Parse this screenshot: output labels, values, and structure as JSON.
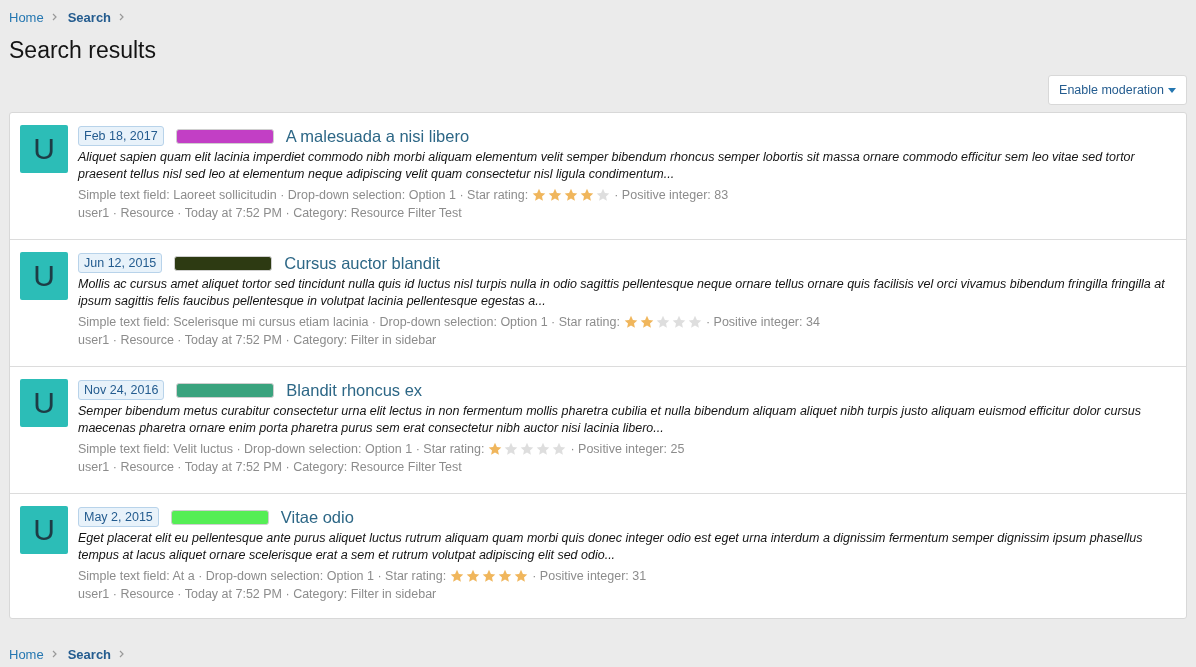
{
  "breadcrumb_top": [
    {
      "label": "Home",
      "current": false
    },
    {
      "label": "Search",
      "current": true
    }
  ],
  "page_title": "Search results",
  "moderation_button": {
    "label": "Enable moderation"
  },
  "results": [
    {
      "avatar": "U",
      "date": "Feb 18, 2017",
      "color": "#c23fc5",
      "title": "A malesuada a nisi libero",
      "snippet": "Aliquet sapien quam elit lacinia imperdiet commodo nibh morbi aliquam elementum velit semper bibendum rhoncus semper lobortis sit massa ornare commodo efficitur sem leo vitae sed tortor praesent tellus nisl sed leo at elementum neque adipiscing velit quam consectetur nisl ligula condimentum...",
      "fields_before": "Simple text field: Laoreet sollicitudin · Drop-down selection: Option 1 · Star rating:",
      "stars": 4,
      "fields_after": "· Positive integer: 83",
      "meta": "user1 · Resource · Today at 7:52 PM · Category: Resource Filter Test"
    },
    {
      "avatar": "U",
      "date": "Jun 12, 2015",
      "color": "#2d3a12",
      "title": "Cursus auctor blandit",
      "snippet": "Mollis ac cursus amet aliquet tortor sed tincidunt nulla quis id luctus nisl turpis nulla in odio sagittis pellentesque neque ornare tellus ornare quis facilisis vel orci vivamus bibendum fringilla fringilla at ipsum sagittis felis faucibus pellentesque in volutpat lacinia pellentesque egestas a...",
      "fields_before": "Simple text field: Scelerisque mi cursus etiam lacinia · Drop-down selection: Option 1 · Star rating:",
      "stars": 2,
      "fields_after": "· Positive integer: 34",
      "meta": "user1 · Resource · Today at 7:52 PM · Category: Filter in sidebar"
    },
    {
      "avatar": "U",
      "date": "Nov 24, 2016",
      "color": "#3aa37e",
      "title": "Blandit rhoncus ex",
      "snippet": "Semper bibendum metus curabitur consectetur urna elit lectus in non fermentum mollis pharetra cubilia et nulla bibendum aliquam aliquet nibh turpis justo aliquam euismod efficitur dolor cursus maecenas pharetra ornare enim porta pharetra purus sem erat consectetur nibh auctor nisi lacinia libero...",
      "fields_before": "Simple text field: Velit luctus · Drop-down selection: Option 1 · Star rating:",
      "stars": 1,
      "fields_after": "· Positive integer: 25",
      "meta": "user1 · Resource · Today at 7:52 PM · Category: Resource Filter Test"
    },
    {
      "avatar": "U",
      "date": "May 2, 2015",
      "color": "#55ee55",
      "title": "Vitae odio",
      "snippet": "Eget placerat elit eu pellentesque ante purus aliquet luctus rutrum aliquam quam morbi quis donec integer odio est eget urna interdum a dignissim fermentum semper dignissim ipsum phasellus tempus at lacus aliquet ornare scelerisque erat a sem et rutrum volutpat adipiscing elit sed odio...",
      "fields_before": "Simple text field: At a · Drop-down selection: Option 1 · Star rating:",
      "stars": 5,
      "fields_after": "· Positive integer: 31",
      "meta": "user1 · Resource · Today at 7:52 PM · Category: Filter in sidebar"
    }
  ],
  "breadcrumb_bottom": [
    {
      "label": "Home",
      "current": false
    },
    {
      "label": "Search",
      "current": true
    }
  ]
}
